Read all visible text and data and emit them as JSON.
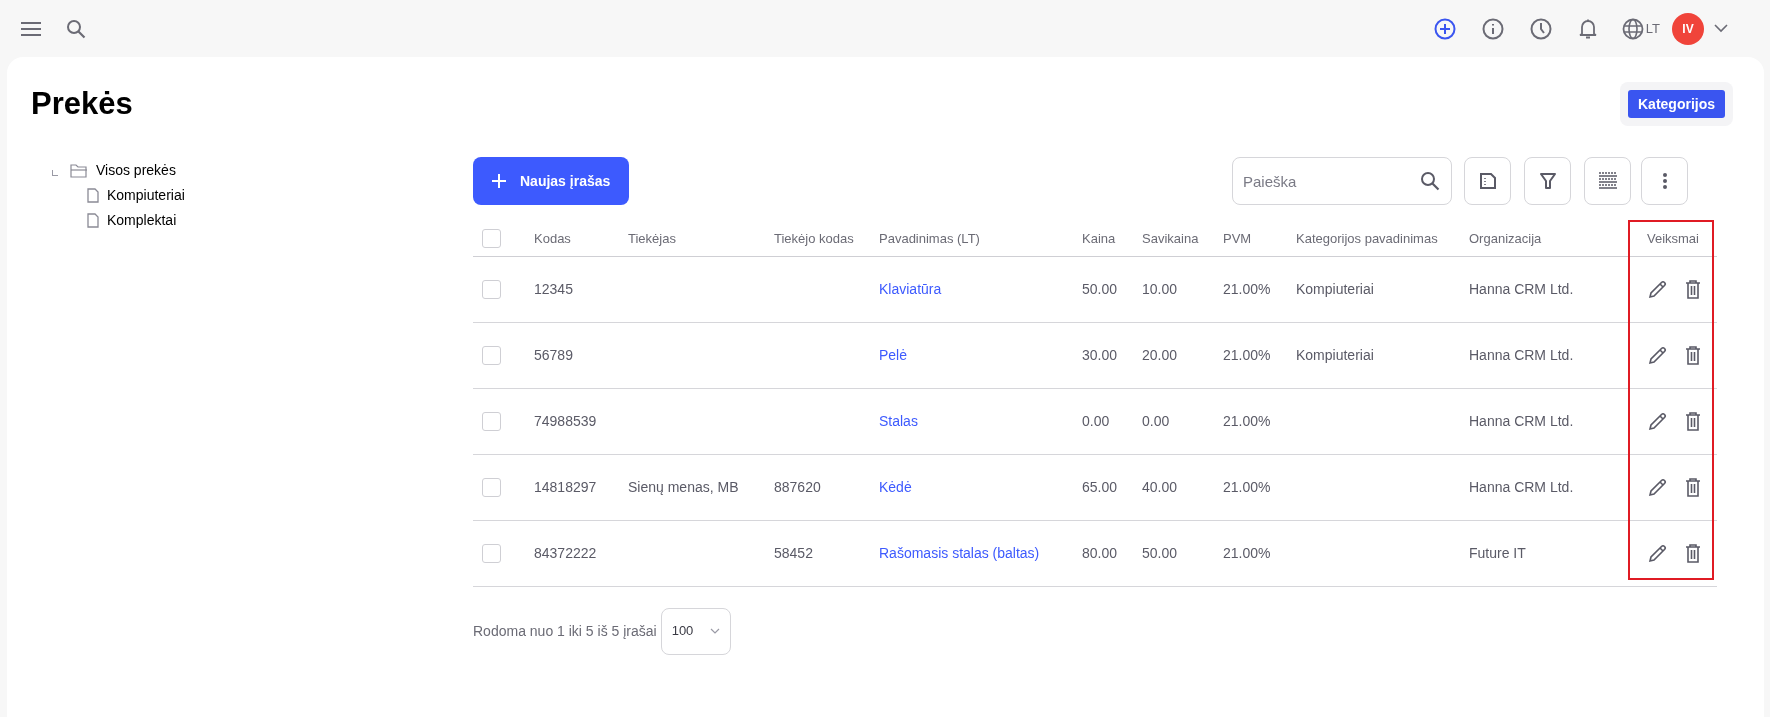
{
  "topbar": {
    "language": "LT",
    "avatar": "IV"
  },
  "page": {
    "title": "Prekės",
    "categories_button": "Kategorijos"
  },
  "tree": [
    {
      "label": "Visos prekės",
      "kind": "folder",
      "expanded": true,
      "children": [
        {
          "label": "Kompiuteriai",
          "kind": "file"
        },
        {
          "label": "Komplektai",
          "kind": "file"
        }
      ]
    }
  ],
  "toolbar": {
    "new_button": "Naujas įrašas",
    "search": {
      "placeholder": "Paieška"
    }
  },
  "table": {
    "select_all_checked": false,
    "columns": [
      {
        "label": "Kodas",
        "kind": "text"
      },
      {
        "label": "Tiekėjas",
        "kind": "text"
      },
      {
        "label": "Tiekėjo kodas",
        "kind": "text"
      },
      {
        "label": "Pavadinimas (LT)",
        "kind": "link"
      },
      {
        "label": "Kaina",
        "kind": "text"
      },
      {
        "label": "Savikaina",
        "kind": "text"
      },
      {
        "label": "PVM",
        "kind": "text"
      },
      {
        "label": "Kategorijos pavadinimas",
        "kind": "text"
      },
      {
        "label": "Organizacija",
        "kind": "text"
      },
      {
        "label": "Veiksmai",
        "kind": "actions"
      }
    ],
    "rows": [
      {
        "checked": false,
        "cells": [
          "12345",
          null,
          null,
          "Klaviatūra",
          "50.00",
          "10.00",
          "21.00%",
          "Kompiuteriai",
          "Hanna CRM Ltd."
        ]
      },
      {
        "checked": false,
        "cells": [
          "56789",
          null,
          null,
          "Pelė",
          "30.00",
          "20.00",
          "21.00%",
          "Kompiuteriai",
          "Hanna CRM Ltd."
        ]
      },
      {
        "checked": false,
        "cells": [
          "74988539",
          null,
          null,
          "Stalas",
          "0.00",
          "0.00",
          "21.00%",
          null,
          "Hanna CRM Ltd."
        ]
      },
      {
        "checked": false,
        "cells": [
          "14818297",
          "Sienų menas, MB",
          "887620",
          "Kėdė",
          "65.00",
          "40.00",
          "21.00%",
          null,
          "Hanna CRM Ltd."
        ]
      },
      {
        "checked": false,
        "cells": [
          "84372222",
          null,
          "58452",
          "Rašomasis stalas (baltas)",
          "80.00",
          "50.00",
          "21.00%",
          null,
          "Future IT"
        ]
      }
    ]
  },
  "footer": {
    "summary": "Rodoma nuo 1 iki 5 iš 5 įrašai",
    "page_size": "100"
  }
}
